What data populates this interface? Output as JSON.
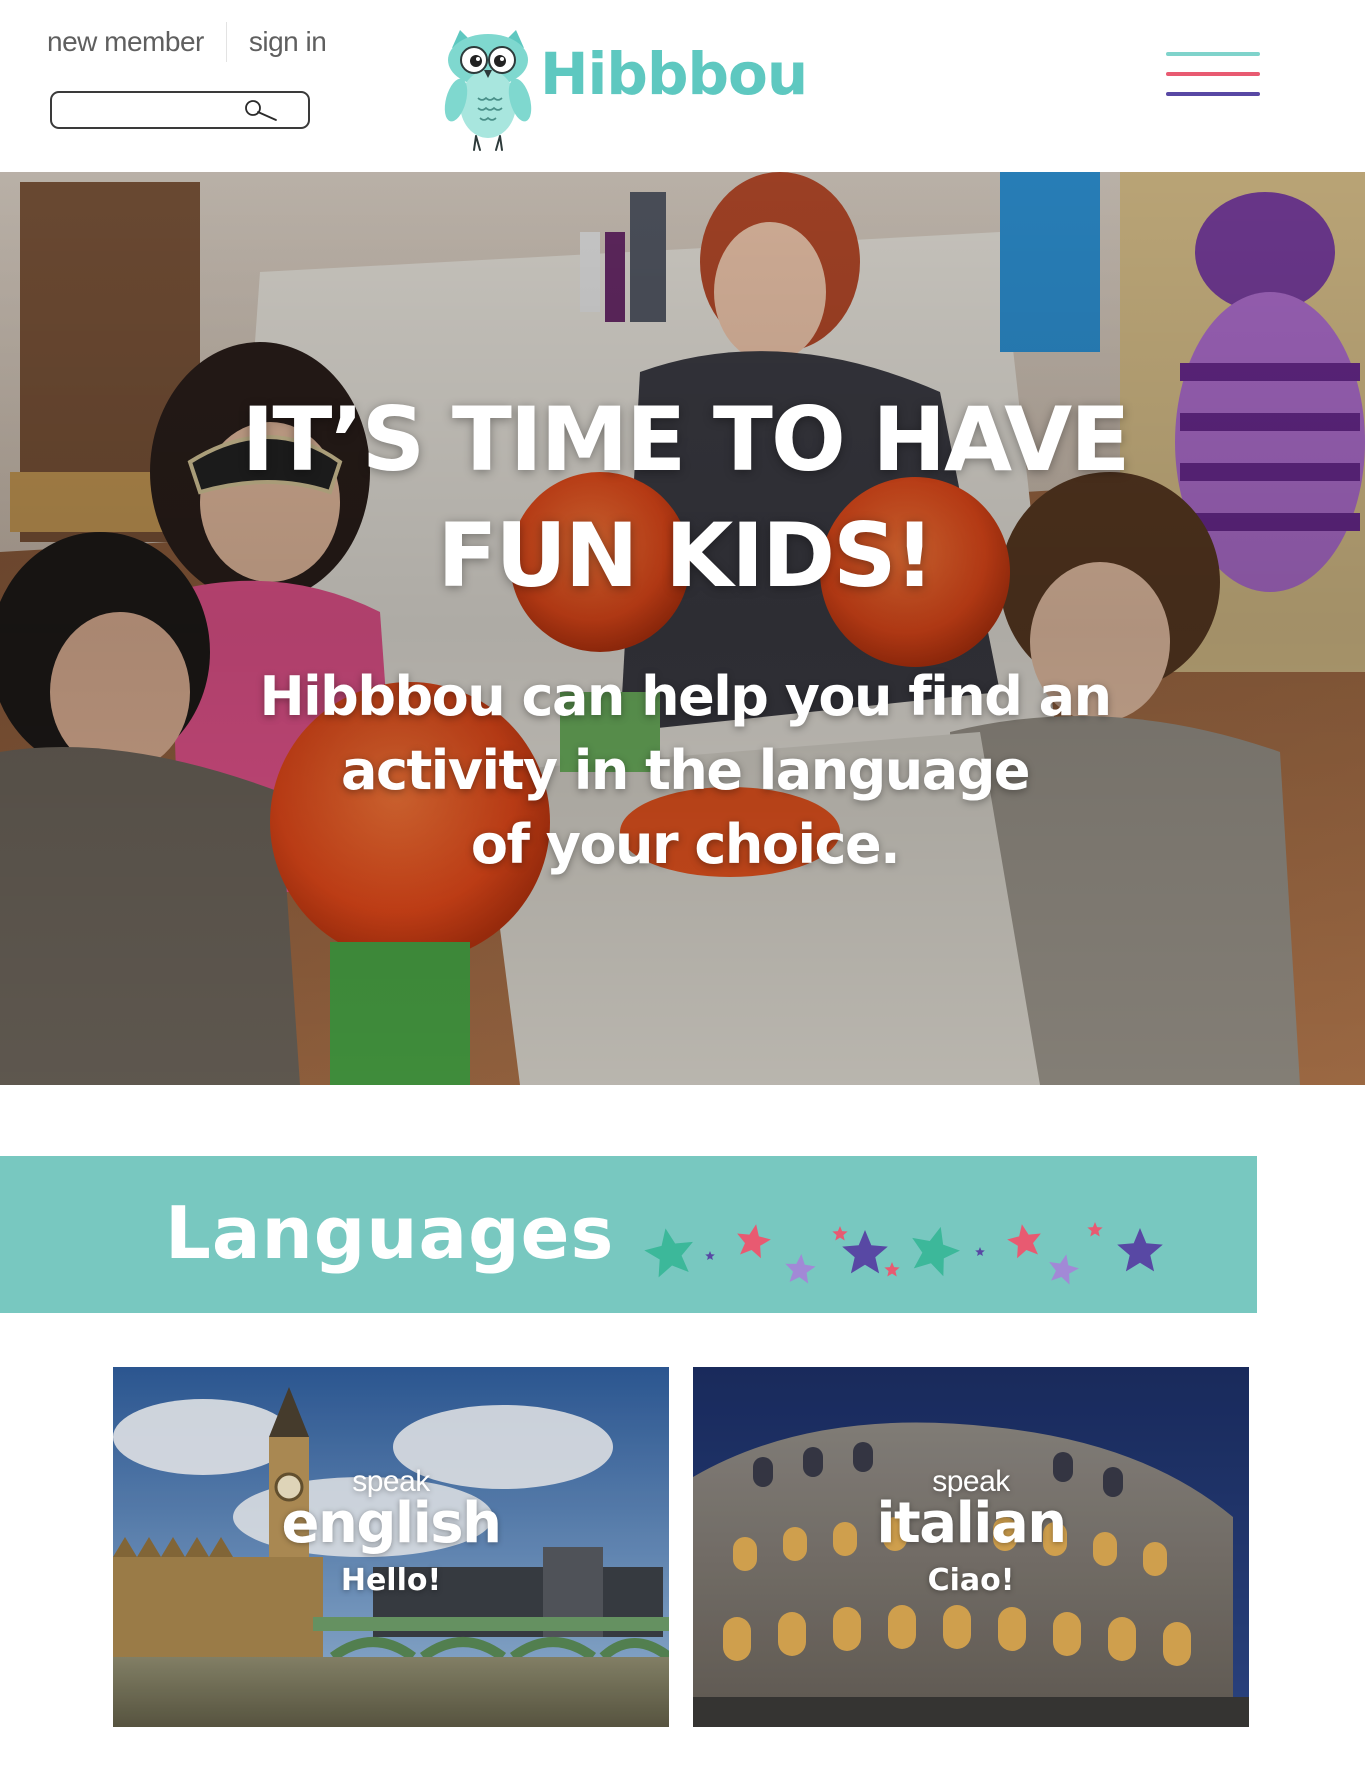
{
  "header": {
    "new_member_label": "new member",
    "sign_in_label": "sign in",
    "search_placeholder": "",
    "logo_text": "Hibbbou",
    "menu_colors": [
      "#7fd3cb",
      "#e85a71",
      "#5848a4"
    ]
  },
  "hero": {
    "title_line1": "IT’S TIME TO HAVE",
    "title_line2": "FUN KIDS!",
    "subtitle_line1": "Hibbbou can help you find an",
    "subtitle_line2": "activity in the language",
    "subtitle_line3": "of your choice."
  },
  "languages": {
    "title": "Languages",
    "banner_color": "#78c8c0",
    "star_colors": [
      "#3cb89a",
      "#5848a4",
      "#e85a71",
      "#a289d6"
    ]
  },
  "cards": [
    {
      "speak": "speak",
      "language": "english",
      "greeting": "Hello!"
    },
    {
      "speak": "speak",
      "language": "italian",
      "greeting": "Ciao!"
    }
  ],
  "colors": {
    "brand_teal": "#5ec8c0",
    "text_gray": "#5f5f5f"
  }
}
